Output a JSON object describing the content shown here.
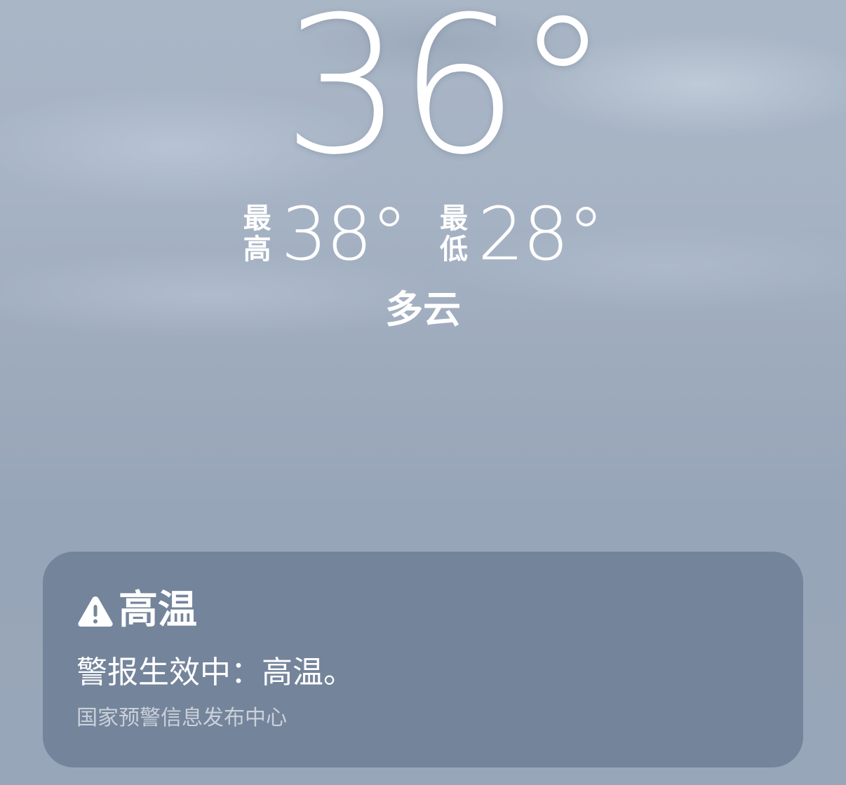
{
  "weather": {
    "current_temp": "36°",
    "high_label": [
      "最",
      "高"
    ],
    "high_value": "38°",
    "low_label": [
      "最",
      "低"
    ],
    "low_value": "28°",
    "condition": "多云"
  },
  "alert": {
    "icon": "warning-triangle-icon",
    "title": "高温",
    "message": "警报生效中：高温。",
    "source": "国家预警信息发布中心"
  }
}
